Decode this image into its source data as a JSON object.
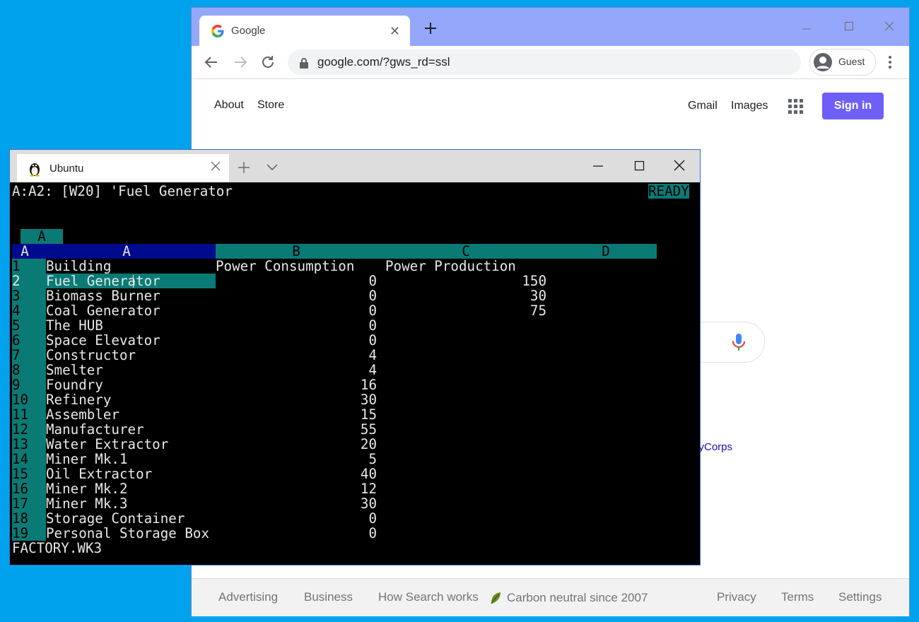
{
  "chrome": {
    "tab_title": "Google",
    "url": "google.com/?gws_rd=ssl",
    "profile_label": "Guest",
    "nav_left": [
      "About",
      "Store"
    ],
    "nav_right": {
      "gmail": "Gmail",
      "images": "Images",
      "sign_in": "Sign in"
    },
    "promo_link": "toryCorps",
    "footer": {
      "advertising": "Advertising",
      "business": "Business",
      "how_search": "How Search works",
      "carbon": "Carbon neutral since 2007",
      "privacy": "Privacy",
      "terms": "Terms",
      "settings": "Settings"
    },
    "colors": {
      "titlebar": "#94a7fb",
      "sign_in": "#6e60f7",
      "desktop": "#00a2ed"
    }
  },
  "terminal": {
    "tab_title": "Ubuntu",
    "status_line": "A:A2: [W20] 'Fuel Generator",
    "mode_indicator": "READY",
    "sheet_tab": "A",
    "corner": "A",
    "columns": [
      "A",
      "B",
      "C",
      "D"
    ],
    "headers": {
      "a": "Building",
      "b": "Power Consumption",
      "c": "Power Production"
    },
    "rows": [
      {
        "num": "2",
        "building": "Fuel Generator",
        "consumption": "0",
        "production": "150"
      },
      {
        "num": "3",
        "building": "Biomass Burner",
        "consumption": "0",
        "production": "30"
      },
      {
        "num": "4",
        "building": "Coal Generator",
        "consumption": "0",
        "production": "75"
      },
      {
        "num": "5",
        "building": "The HUB",
        "consumption": "0",
        "production": ""
      },
      {
        "num": "6",
        "building": "Space Elevator",
        "consumption": "0",
        "production": ""
      },
      {
        "num": "7",
        "building": "Constructor",
        "consumption": "4",
        "production": ""
      },
      {
        "num": "8",
        "building": "Smelter",
        "consumption": "4",
        "production": ""
      },
      {
        "num": "9",
        "building": "Foundry",
        "consumption": "16",
        "production": ""
      },
      {
        "num": "10",
        "building": "Refinery",
        "consumption": "30",
        "production": ""
      },
      {
        "num": "11",
        "building": "Assembler",
        "consumption": "15",
        "production": ""
      },
      {
        "num": "12",
        "building": "Manufacturer",
        "consumption": "55",
        "production": ""
      },
      {
        "num": "13",
        "building": "Water Extractor",
        "consumption": "20",
        "production": ""
      },
      {
        "num": "14",
        "building": "Miner Mk.1",
        "consumption": "5",
        "production": ""
      },
      {
        "num": "15",
        "building": "Oil Extractor",
        "consumption": "40",
        "production": ""
      },
      {
        "num": "16",
        "building": "Miner Mk.2",
        "consumption": "12",
        "production": ""
      },
      {
        "num": "17",
        "building": "Miner Mk.3",
        "consumption": "30",
        "production": ""
      },
      {
        "num": "18",
        "building": "Storage Container",
        "consumption": "0",
        "production": ""
      },
      {
        "num": "19",
        "building": "Personal Storage Box",
        "consumption": "0",
        "production": ""
      }
    ],
    "header_row_num": "1",
    "filename": "FACTORY.WK3",
    "colors": {
      "highlight": "#0a7a75",
      "selected": "#000a8c"
    }
  }
}
